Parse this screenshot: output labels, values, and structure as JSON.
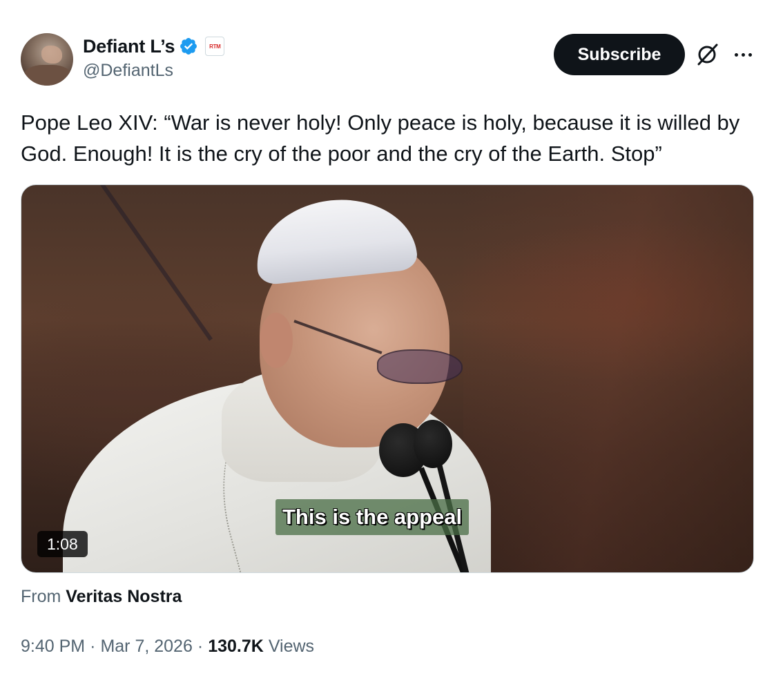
{
  "author": {
    "display_name": "Defiant L’s",
    "handle": "@DefiantLs",
    "verified_icon": "verified-badge-icon",
    "affiliate_badge": "RTM",
    "verified_color": "#1d9bf0"
  },
  "actions": {
    "subscribe_label": "Subscribe",
    "grok_icon": "grok-icon",
    "more_icon": "more-options-icon"
  },
  "tweet": {
    "text": "Pope Leo XIV: “War is never holy!  Only peace is holy, because it is willed by God. Enough! It is the cry of the poor and the cry of the Earth. Stop”"
  },
  "video": {
    "caption": "This is the appeal",
    "duration": "1:08"
  },
  "source": {
    "prefix": "From",
    "name": "Veritas Nostra"
  },
  "meta": {
    "time": "9:40 PM",
    "separator": "·",
    "date": "Mar 7, 2026",
    "views_count": "130.7K",
    "views_label": "Views"
  },
  "colors": {
    "text_primary": "#0f1419",
    "text_secondary": "#536471",
    "button_bg": "#0f1419"
  }
}
